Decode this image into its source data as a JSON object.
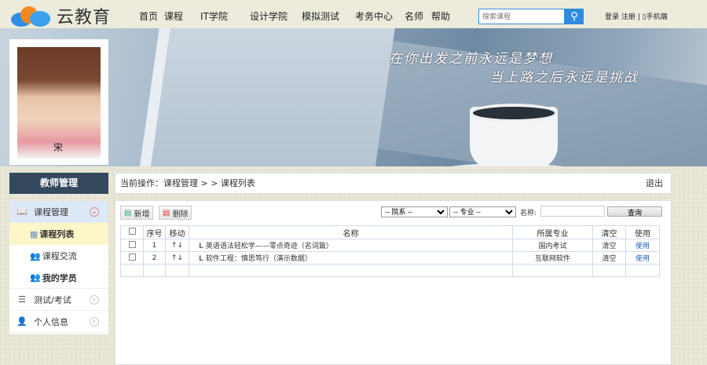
{
  "header": {
    "logo_text": "云教育",
    "nav": [
      "首页",
      "课程",
      "IT学院",
      "设计学院",
      "模拟测试",
      "考务中心",
      "名师",
      "帮助"
    ],
    "search_placeholder": "搜索课程",
    "auth": "登录 注册 | ▯手机端"
  },
  "banner": {
    "quote_line1": "在你出发之前永远是梦想",
    "quote_line2": "当上路之后永远是挑战"
  },
  "profile": {
    "name": "宋"
  },
  "sidebar": {
    "title": "教师管理",
    "items": [
      {
        "label": "课程管理",
        "icon": "book-icon",
        "expanded": true,
        "children": [
          {
            "label": "课程列表",
            "icon": "grid-icon",
            "active": true
          },
          {
            "label": "课程交流",
            "icon": "users-icon"
          },
          {
            "label": "我的学员",
            "icon": "users-icon"
          }
        ]
      },
      {
        "label": "测试/考试",
        "icon": "list-icon"
      },
      {
        "label": "个人信息",
        "icon": "user-icon"
      }
    ]
  },
  "breadcrumb": {
    "text": "当前操作：课程管理 > > 课程列表",
    "logout": "退出"
  },
  "toolbar": {
    "add": "新增",
    "delete": "删除",
    "dept_select": "-- 院系 --",
    "major_select": "-- 专业 --",
    "name_label": "名称:",
    "name_value": "",
    "query": "查询"
  },
  "table": {
    "headers": [
      "序号",
      "移动",
      "名称",
      "所属专业",
      "清空",
      "使用"
    ],
    "rows": [
      {
        "no": "1",
        "move": "↑↓",
        "name": "英语语法轻松学——零点奇迹（名词篇）",
        "major": "国内考试",
        "clear": "清空",
        "use": "使用"
      },
      {
        "no": "2",
        "move": "↑↓",
        "name": "软件工程：慎思笃行（演示数据）",
        "major": "互联网软件",
        "clear": "清空",
        "use": "使用"
      }
    ]
  },
  "colors": {
    "sidebar_title": "#34495e",
    "active_sub": "#fdf6c9",
    "expanded_item": "#dde9f7",
    "link": "#1a5fb4"
  }
}
